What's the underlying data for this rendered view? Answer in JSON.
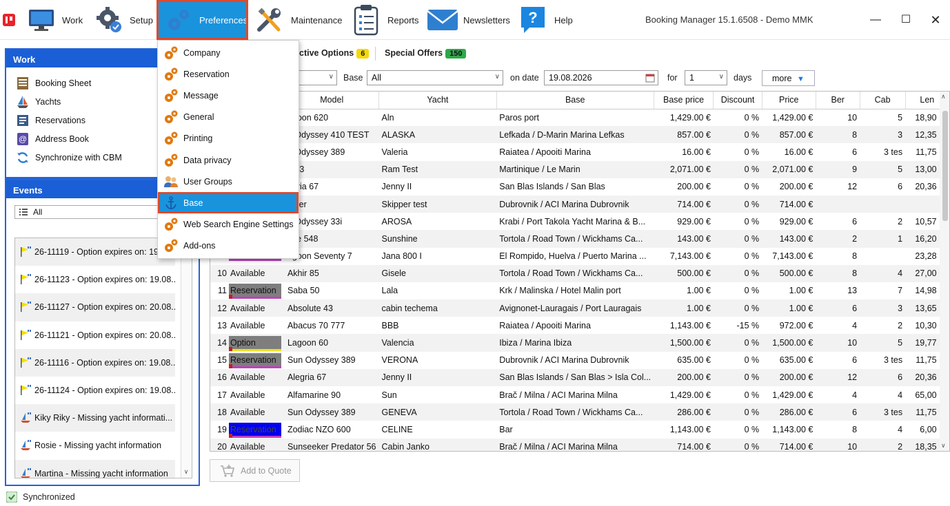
{
  "toolbar": {
    "app_logo": "app-logo-icon",
    "work": "Work",
    "setup": "Setup",
    "preferences": "Preferences",
    "maintenance": "Maintenance",
    "reports": "Reports",
    "newsletters": "Newsletters",
    "help": "Help",
    "window_title": "Booking Manager 15.1.6508 - Demo MMK"
  },
  "colors": {
    "accent": "#1a93dd",
    "highlight_border": "#e0492a",
    "panel_blue": "#1a5fd6"
  },
  "work_panel": {
    "title": "Work",
    "items": [
      {
        "label": "Booking Sheet",
        "icon": "booking-sheet-icon"
      },
      {
        "label": "Yachts",
        "icon": "sailboat-icon"
      },
      {
        "label": "Reservations",
        "icon": "reservations-icon"
      },
      {
        "label": "Address Book",
        "icon": "address-book-icon"
      },
      {
        "label": "Synchronize with CBM",
        "icon": "sync-icon"
      }
    ]
  },
  "events_panel": {
    "title": "Events",
    "filter": "All",
    "items": [
      {
        "text": "26-11119 - Option expires on: 19.0",
        "icon": "flag-icon"
      },
      {
        "text": "26-11123 - Option expires on: 19.08...",
        "icon": "flag-icon"
      },
      {
        "text": "26-11127 - Option expires on: 20.08...",
        "icon": "flag-icon"
      },
      {
        "text": "26-11121 - Option expires on: 20.08...",
        "icon": "flag-icon"
      },
      {
        "text": "26-11116 - Option expires on: 19.08...",
        "icon": "flag-icon"
      },
      {
        "text": "26-11124 - Option expires on: 19.08...",
        "icon": "flag-icon"
      },
      {
        "text": "Kiky Riky - Missing yacht informati...",
        "icon": "boat-icon"
      },
      {
        "text": "Rosie - Missing yacht information",
        "icon": "boat-icon"
      },
      {
        "text": "Martina - Missing yacht information",
        "icon": "boat-icon"
      }
    ]
  },
  "tabs": {
    "active_options_label": "ctive Options",
    "active_options_count": "6",
    "special_offers_label": "Special Offers",
    "special_offers_count": "150"
  },
  "filters": {
    "base_label": "Base",
    "base_value": "All",
    "on_date_label": "on date",
    "date_value": "19.08.2026",
    "for_label": "for",
    "days_value": "1",
    "days_label": "days",
    "more_label": "more"
  },
  "grid": {
    "columns": [
      "Model",
      "Yacht",
      "Base",
      "Base price",
      "Discount",
      "Price",
      "Ber",
      "Cab",
      "Len"
    ],
    "rows": [
      {
        "no": "",
        "status": "",
        "model": "agoon 620",
        "yacht": "Aln",
        "base": "Paros port",
        "base_price": "1,429.00 €",
        "discount": "0 %",
        "price": "1,429.00 €",
        "ber": "10",
        "cab": "5",
        "len": "18,90 m"
      },
      {
        "no": "",
        "status": "",
        "model": "n Odyssey 410 TEST",
        "yacht": "ALASKA",
        "base": "Lefkada / D-Marin Marina Lefkas",
        "base_price": "857.00 €",
        "discount": "0 %",
        "price": "857.00 €",
        "ber": "8",
        "cab": "3",
        "len": "12,35 m"
      },
      {
        "no": "",
        "status": "",
        "model": "n Odyssey 389",
        "yacht": "Valeria",
        "base": "Raiatea / Apooiti Marina",
        "base_price": "16.00 €",
        "discount": "0 %",
        "price": "16.00 €",
        "ber": "6",
        "cab": "3 tes",
        "len": "11,75 m"
      },
      {
        "no": "",
        "status": "",
        "model": "n 43",
        "yacht": "Ram Test",
        "base": "Martinique / Le Marin",
        "base_price": "2,071.00 €",
        "discount": "0 %",
        "price": "2,071.00 €",
        "ber": "9",
        "cab": "5",
        "len": "13,00 m"
      },
      {
        "no": "",
        "status": "",
        "model": "egria 67",
        "yacht": "Jenny II",
        "base": "San Blas Islands / San Blas",
        "base_price": "200.00 €",
        "discount": "0 %",
        "price": "200.00 €",
        "ber": "12",
        "cab": "6",
        "len": "20,36 m"
      },
      {
        "no": "",
        "status": "",
        "model": "ipper",
        "yacht": "Skipper test",
        "base": "Dubrovnik / ACI Marina Dubrovnik",
        "base_price": "714.00 €",
        "discount": "0 %",
        "price": "714.00 €",
        "ber": "",
        "cab": "",
        "len": ""
      },
      {
        "no": "",
        "status": "",
        "model": "n Odyssey 33i",
        "yacht": "AROSA",
        "base": "Krabi / Port Takola Yacht Marina & B...",
        "base_price": "929.00 €",
        "discount": "0 %",
        "price": "929.00 €",
        "ber": "6",
        "cab": "2",
        "len": "10,57 m"
      },
      {
        "no": "",
        "status": "",
        "model": "nse 548",
        "yacht": "Sunshine",
        "base": "Tortola / Road Town / Wickhams Ca...",
        "base_price": "143.00 €",
        "discount": "0 %",
        "price": "143.00 €",
        "ber": "2",
        "cab": "1",
        "len": "16,20 m"
      },
      {
        "no": "",
        "status": "",
        "model": "agoon Seventy 7",
        "yacht": "Jana 800 I",
        "base": "El Rompido, Huelva / Puerto Marina ...",
        "base_price": "7,143.00 €",
        "discount": "0 %",
        "price": "7,143.00 €",
        "ber": "8",
        "cab": "",
        "len": "23,28 m"
      },
      {
        "no": "10",
        "status": "Available",
        "model": "Akhir 85",
        "yacht": "Gisele",
        "base": "Tortola / Road Town / Wickhams Ca...",
        "base_price": "500.00 €",
        "discount": "0 %",
        "price": "500.00 €",
        "ber": "8",
        "cab": "4",
        "len": "27,00 m"
      },
      {
        "no": "11",
        "status": "Reservation",
        "model": "Saba 50",
        "yacht": "Lala",
        "base": "Krk / Malinska / Hotel Malin port",
        "base_price": "1.00 €",
        "discount": "0 %",
        "price": "1.00 €",
        "ber": "13",
        "cab": "7",
        "len": "14,98 m"
      },
      {
        "no": "12",
        "status": "Available",
        "model": "Absolute 43",
        "yacht": "cabin techema",
        "base": "Avignonet-Lauragais / Port Lauragais",
        "base_price": "1.00 €",
        "discount": "0 %",
        "price": "1.00 €",
        "ber": "6",
        "cab": "3",
        "len": "13,65 m"
      },
      {
        "no": "13",
        "status": "Available",
        "model": "Abacus 70 777",
        "yacht": "BBB",
        "base": "Raiatea / Apooiti Marina",
        "base_price": "1,143.00 €",
        "discount": "-15 %",
        "price": "972.00 €",
        "ber": "4",
        "cab": "2",
        "len": "10,30 m"
      },
      {
        "no": "14",
        "status": "Option",
        "model": "Lagoon 60",
        "yacht": "Valencia",
        "base": "Ibiza / Marina Ibiza",
        "base_price": "1,500.00 €",
        "discount": "0 %",
        "price": "1,500.00 €",
        "ber": "10",
        "cab": "5",
        "len": "19,77 m"
      },
      {
        "no": "15",
        "status": "Reservation",
        "model": "Sun Odyssey 389",
        "yacht": "VERONA",
        "base": "Dubrovnik / ACI Marina Dubrovnik",
        "base_price": "635.00 €",
        "discount": "0 %",
        "price": "635.00 €",
        "ber": "6",
        "cab": "3 tes",
        "len": "11,75 m"
      },
      {
        "no": "16",
        "status": "Available",
        "model": "Alegria 67",
        "yacht": "Jenny II",
        "base": "San Blas Islands / San Blas > Isla Col...",
        "base_price": "200.00 €",
        "discount": "0 %",
        "price": "200.00 €",
        "ber": "12",
        "cab": "6",
        "len": "20,36 m"
      },
      {
        "no": "17",
        "status": "Available",
        "model": "Alfamarine 90",
        "yacht": "Sun",
        "base": "Brač / Milna / ACI Marina Milna",
        "base_price": "1,429.00 €",
        "discount": "0 %",
        "price": "1,429.00 €",
        "ber": "4",
        "cab": "4",
        "len": "65,00 m"
      },
      {
        "no": "18",
        "status": "Available",
        "model": "Sun Odyssey 389",
        "yacht": "GENEVA",
        "base": "Tortola / Road Town / Wickhams Ca...",
        "base_price": "286.00 €",
        "discount": "0 %",
        "price": "286.00 €",
        "ber": "6",
        "cab": "3 tes",
        "len": "11,75 m"
      },
      {
        "no": "19",
        "status": "Reservation",
        "model": "Zodiac NZO 600",
        "yacht": "CELINE",
        "base": "Bar",
        "base_price": "1,143.00 €",
        "discount": "0 %",
        "price": "1,143.00 €",
        "ber": "8",
        "cab": "4",
        "len": "6,00 m"
      },
      {
        "no": "20",
        "status": "Available",
        "model": "Sunseeker Predator 56",
        "yacht": "Cabin Janko",
        "base": "Brač / Milna / ACI Marina Milna",
        "base_price": "714.00 €",
        "discount": "0 %",
        "price": "714.00 €",
        "ber": "10",
        "cab": "2",
        "len": "18,35 m"
      }
    ]
  },
  "add_to_quote": "Add to Quote",
  "status_bar": {
    "text": "Synchronized"
  },
  "prefs_menu": {
    "items": [
      {
        "label": "Company",
        "icon": "gears-icon"
      },
      {
        "label": "Reservation",
        "icon": "gears-icon"
      },
      {
        "label": "Message",
        "icon": "gears-icon"
      },
      {
        "label": "General",
        "icon": "gears-icon"
      },
      {
        "label": "Printing",
        "icon": "gears-icon"
      },
      {
        "label": "Data privacy",
        "icon": "gears-icon"
      },
      {
        "label": "User Groups",
        "icon": "user-groups-icon"
      },
      {
        "label": "Base",
        "icon": "anchor-icon"
      },
      {
        "label": "Web Search Engine Settings",
        "icon": "gears-icon"
      },
      {
        "label": "Add-ons",
        "icon": "gears-icon"
      }
    ]
  }
}
